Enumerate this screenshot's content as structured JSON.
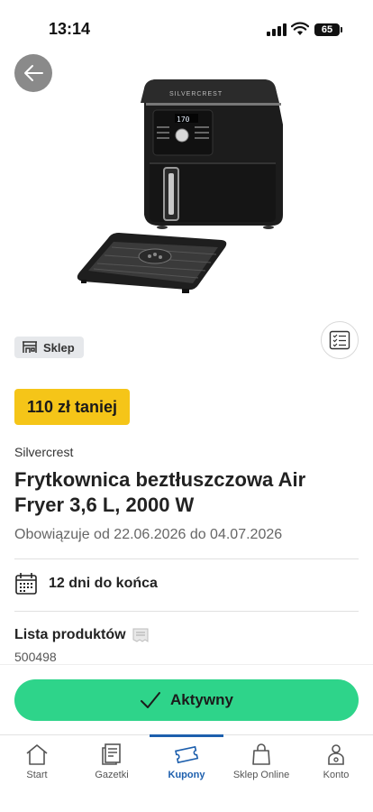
{
  "status_bar": {
    "time": "13:14",
    "battery": "65"
  },
  "store_badge": {
    "label": "Sklep"
  },
  "discount": {
    "label": "110 zł taniej"
  },
  "product": {
    "brand": "Silvercrest",
    "title": "Frytkownica beztłuszczowa Air Fryer 3,6 L, 2000 W",
    "validity": "Obowiązuje od 22.06.2026 do 04.07.2026",
    "display_readout": "170"
  },
  "days_left": {
    "label": "12 dni do końca"
  },
  "product_list": {
    "title": "Lista produktów",
    "number": "500498"
  },
  "action": {
    "label": "Aktywny"
  },
  "tabbar": {
    "tabs": [
      {
        "label": "Start",
        "icon": "home-icon"
      },
      {
        "label": "Gazetki",
        "icon": "leaflet-icon"
      },
      {
        "label": "Kupony",
        "icon": "coupon-icon",
        "active": true
      },
      {
        "label": "Sklep Online",
        "icon": "shopping-bag-icon"
      },
      {
        "label": "Konto",
        "icon": "account-icon"
      }
    ]
  },
  "colors": {
    "accent_green": "#2ed48a",
    "badge_yellow": "#f5c518",
    "active_tab_blue": "#1d5fad"
  }
}
